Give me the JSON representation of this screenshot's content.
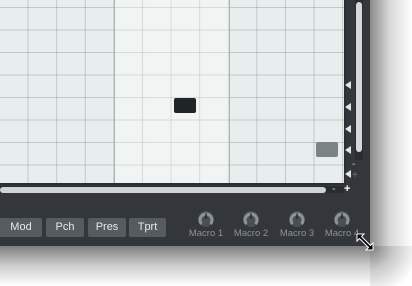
{
  "controls": {
    "buttons": [
      "Mod",
      "Pch",
      "Pres",
      "Tprt"
    ],
    "macros": [
      "Macro 1",
      "Macro 2",
      "Macro 3",
      "Macro 4"
    ]
  },
  "zoom": {
    "minus": "-",
    "plus": "+"
  },
  "colors": {
    "grid_bg": "#e8eeed",
    "selected_note": "#1f2426",
    "unselected_note": "#7b8483",
    "panel_bg": "#33373b",
    "button_bg": "#555b5f"
  },
  "icons": {
    "knob": "macro-knob-icon",
    "cursor": "resize-cursor-icon",
    "lane_arrow": "left-triangle-icon"
  }
}
